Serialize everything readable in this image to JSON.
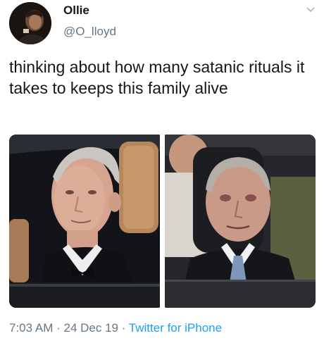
{
  "author": {
    "display_name": "Ollie",
    "handle": "@O_lloyd",
    "avatar_icon": "profile-photo"
  },
  "menu_icon": "chevron-down-icon",
  "tweet": {
    "text": "thinking about how many satanic rituals it takes to keeps this family alive"
  },
  "media": [
    {
      "icon": "photo-man-in-car-left"
    },
    {
      "icon": "photo-man-in-car-right"
    }
  ],
  "meta": {
    "time": "7:03 AM",
    "separator1": " · ",
    "date": "24 Dec 19",
    "separator2": " · ",
    "source": "Twitter for iPhone"
  },
  "colors": {
    "text": "#14171a",
    "secondary": "#657786",
    "link": "#1da1f2"
  }
}
